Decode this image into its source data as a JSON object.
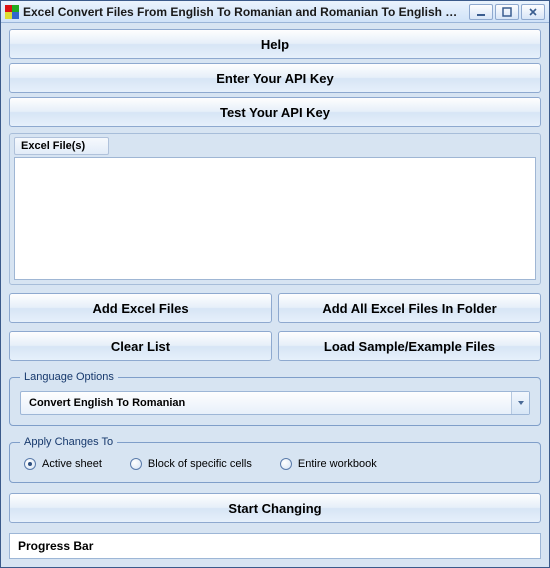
{
  "titlebar": {
    "title": "Excel Convert Files From English To Romanian and Romanian To English S..."
  },
  "buttons": {
    "help": "Help",
    "enter_api": "Enter Your API Key",
    "test_api": "Test Your API Key",
    "add_files": "Add Excel Files",
    "add_folder": "Add All Excel Files In Folder",
    "clear_list": "Clear List",
    "load_sample": "Load Sample/Example Files",
    "start": "Start Changing"
  },
  "filebox": {
    "header": "Excel File(s)"
  },
  "language": {
    "legend": "Language Options",
    "selected": "Convert English To Romanian"
  },
  "apply": {
    "legend": "Apply Changes To",
    "options": {
      "active": "Active sheet",
      "block": "Block of specific cells",
      "entire": "Entire workbook"
    }
  },
  "progress": {
    "label": "Progress Bar"
  }
}
